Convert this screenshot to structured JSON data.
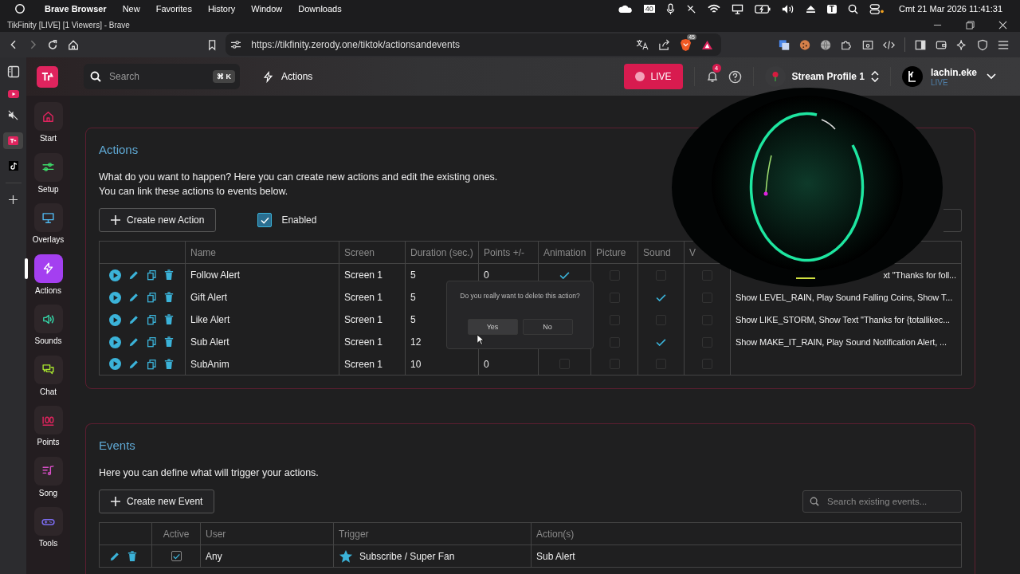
{
  "menu_bar": {
    "app": "Brave Browser",
    "items": [
      "New",
      "Favorites",
      "History",
      "Window",
      "Downloads"
    ],
    "tray_badge": "40",
    "tray_letter": "T",
    "clock": "Cmt 21 Mar 2026 11:41:31"
  },
  "window": {
    "title": "TikFinity [LIVE] [1 Viewers] - Brave"
  },
  "browser": {
    "url": "https://tikfinity.zerody.one/tiktok/actionsandevents",
    "shield_count": "45"
  },
  "app_header": {
    "search_placeholder": "Search",
    "shortcut": "⌘ K",
    "page": "Actions",
    "live_button": "LIVE",
    "notifications": "4",
    "profile": "Stream Profile 1",
    "user_name": "lachin.eke",
    "user_status": "LIVE"
  },
  "nav": [
    {
      "label": "Start",
      "selected": false
    },
    {
      "label": "Setup",
      "selected": false
    },
    {
      "label": "Overlays",
      "selected": false
    },
    {
      "label": "Actions",
      "selected": true
    },
    {
      "label": "Sounds",
      "selected": false
    },
    {
      "label": "Chat",
      "selected": false
    },
    {
      "label": "Points",
      "selected": false
    },
    {
      "label": "Song",
      "selected": false
    },
    {
      "label": "Tools",
      "selected": false
    }
  ],
  "actions": {
    "title": "Actions",
    "intro": [
      "What do you want to happen? Here you can create new actions and edit the existing ones.",
      "You can link these actions to events below."
    ],
    "create_button": "Create new Action",
    "enabled": {
      "label": "Enabled",
      "checked": true
    },
    "columns": {
      "name": "Name",
      "screen": "Screen",
      "duration": "Duration (sec.)",
      "points": "Points +/-",
      "animation": "Animation",
      "picture": "Picture",
      "sound": "Sound",
      "column_9": "V"
    },
    "rows": [
      {
        "name": "Follow Alert",
        "screen": "Screen 1",
        "duration": "5",
        "points": "0",
        "animation": true,
        "picture": false,
        "sound": false,
        "column_9": false,
        "summary": "xt \"Thanks for foll...",
        "cut_left": true
      },
      {
        "name": "Gift Alert",
        "screen": "Screen 1",
        "duration": "5",
        "picture": false,
        "sound": true,
        "column_9": false,
        "summary": "Show LEVEL_RAIN, Play Sound Falling Coins, Show T...",
        "cut_left": false
      },
      {
        "name": "Like Alert",
        "screen": "Screen 1",
        "duration": "5",
        "picture": false,
        "sound": false,
        "column_9": false,
        "summary": "Show LIKE_STORM, Show Text \"Thanks for {totallikec...",
        "cut_left": false
      },
      {
        "name": "Sub Alert",
        "screen": "Screen 1",
        "duration": "12",
        "picture": false,
        "sound": true,
        "column_9": false,
        "summary": "Show MAKE_IT_RAIN, Play Sound Notification Alert, ...",
        "cut_left": false
      },
      {
        "name": "SubAnim",
        "screen": "Screen 1",
        "duration": "10",
        "points": "0",
        "animation": false,
        "picture": false,
        "sound": false,
        "column_9": false
      }
    ]
  },
  "dialog": {
    "question": "Do you really want to delete this action?",
    "buttons": [
      {
        "label": "Yes",
        "hovered": true
      },
      {
        "label": "No",
        "hovered": false
      }
    ]
  },
  "events": {
    "title": "Events",
    "intro": "Here you can define what will trigger your actions.",
    "create_button": "Create new Event",
    "search_placeholder": "Search existing events...",
    "columns": {
      "active": "Active",
      "user": "User",
      "trigger": "Trigger",
      "actions": "Action(s)"
    },
    "rows": [
      {
        "active": true,
        "user": "Any",
        "trigger": "Subscribe / Super Fan",
        "actions": "Sub Alert"
      }
    ]
  }
}
